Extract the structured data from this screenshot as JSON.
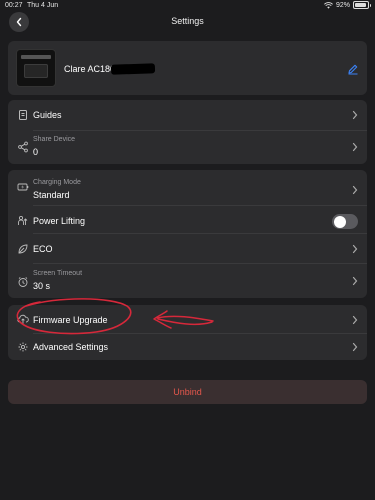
{
  "status_bar": {
    "time": "00:27",
    "date": "Thu 4 Jun",
    "battery": "92%"
  },
  "header": {
    "title": "Settings",
    "back_icon": "chevron-left-icon"
  },
  "device": {
    "name": "Clare AC180",
    "edit_icon": "pencil-icon"
  },
  "group1": {
    "guides_label": "Guides",
    "share_label": "Share Device",
    "share_value": "0"
  },
  "group2": {
    "charging_label": "Charging Mode",
    "charging_value": "Standard",
    "power_lifting_label": "Power Lifting",
    "power_lifting_on": false,
    "eco_label": "ECO",
    "screen_timeout_label": "Screen Timeout",
    "screen_timeout_value": "30 s"
  },
  "group3": {
    "firmware_label": "Firmware Upgrade",
    "advanced_label": "Advanced Settings"
  },
  "unbind_label": "Unbind",
  "colors": {
    "background": "#1c1c1e",
    "card": "#2c2c2e",
    "accent_blue": "#3b82f6",
    "danger": "#e5574c",
    "annotation_red": "#d6283a"
  }
}
